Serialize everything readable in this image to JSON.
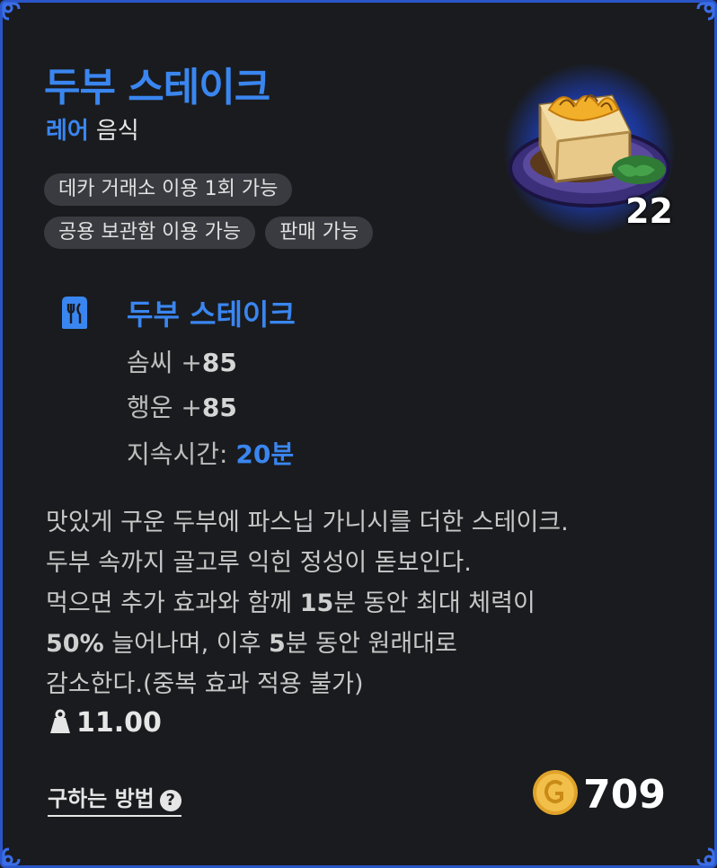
{
  "item": {
    "name": "두부 스테이크",
    "rarity": "레어",
    "type": "음식",
    "count": "22",
    "icon": "tofu-steak-image"
  },
  "tags": [
    "데카 거래소 이용 1회 가능",
    "공용 보관함 이용 가능",
    "판매 가능"
  ],
  "effect": {
    "icon": "food-icon",
    "name": "두부 스테이크",
    "stats": [
      {
        "label": "솜씨 +",
        "value": "85"
      },
      {
        "label": "행운 +",
        "value": "85"
      },
      {
        "label": "지속시간: ",
        "value": "20분"
      }
    ]
  },
  "description": {
    "line1": "맛있게 구운 두부에 파스닙 가니시를 더한 스테이크.",
    "line2": "두부 속까지 골고루 익힌 정성이 돋보인다.",
    "line3_a": "먹으면 추가 효과와 함께 ",
    "line3_b": "15",
    "line3_c": "분 동안 최대 체력이",
    "line4_a": "50%",
    "line4_b": " 늘어나며, 이후 ",
    "line4_c": "5",
    "line4_d": "분 동안 원래대로",
    "line5": "감소한다.(중복 효과 적용 불가)"
  },
  "weight": {
    "icon": "weight-icon",
    "value": "11.00"
  },
  "howto": {
    "label": "구하는 방법",
    "help": "?"
  },
  "price": {
    "icon": "gold-coin-icon",
    "value": "709"
  },
  "colors": {
    "accent": "#3a86f0",
    "border": "#2a55c8",
    "background": "#1a1b1e"
  }
}
